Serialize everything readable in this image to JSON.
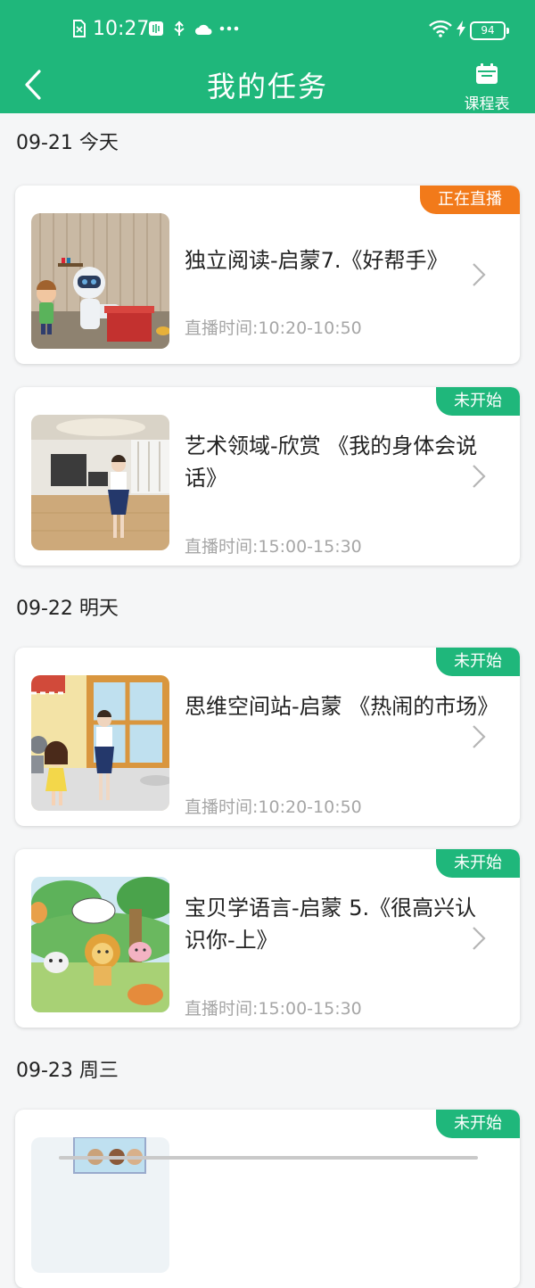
{
  "status_bar": {
    "time": "10:27",
    "battery": "94",
    "icons": [
      "sim-card-icon",
      "app-notification-icon",
      "usb-icon",
      "cloud-icon",
      "more-dots-icon",
      "wifi-icon",
      "charging-icon"
    ]
  },
  "header": {
    "title": "我的任务",
    "schedule_label": "课程表"
  },
  "colors": {
    "brand": "#1fb77b",
    "live_badge": "#f27a1a",
    "not_started_badge": "#1fb77b",
    "muted_text": "#a6a6a6"
  },
  "dates": [
    "09-21 今天",
    "09-22 明天",
    "09-23 周三"
  ],
  "tasks": [
    {
      "badge": "正在直播",
      "title": "独立阅读-启蒙7.《好帮手》",
      "time": "直播时间:10:20-10:50"
    },
    {
      "badge": "未开始",
      "title": "艺术领域-欣赏 《我的身体会说话》",
      "time": "直播时间:15:00-15:30"
    },
    {
      "badge": "未开始",
      "title": "思维空间站-启蒙 《热闹的市场》",
      "time": "直播时间:10:20-10:50"
    },
    {
      "badge": "未开始",
      "title": "宝贝学语言-启蒙 5.《很高兴认识你-上》",
      "time": "直播时间:15:00-15:30"
    },
    {
      "badge": "未开始"
    }
  ]
}
